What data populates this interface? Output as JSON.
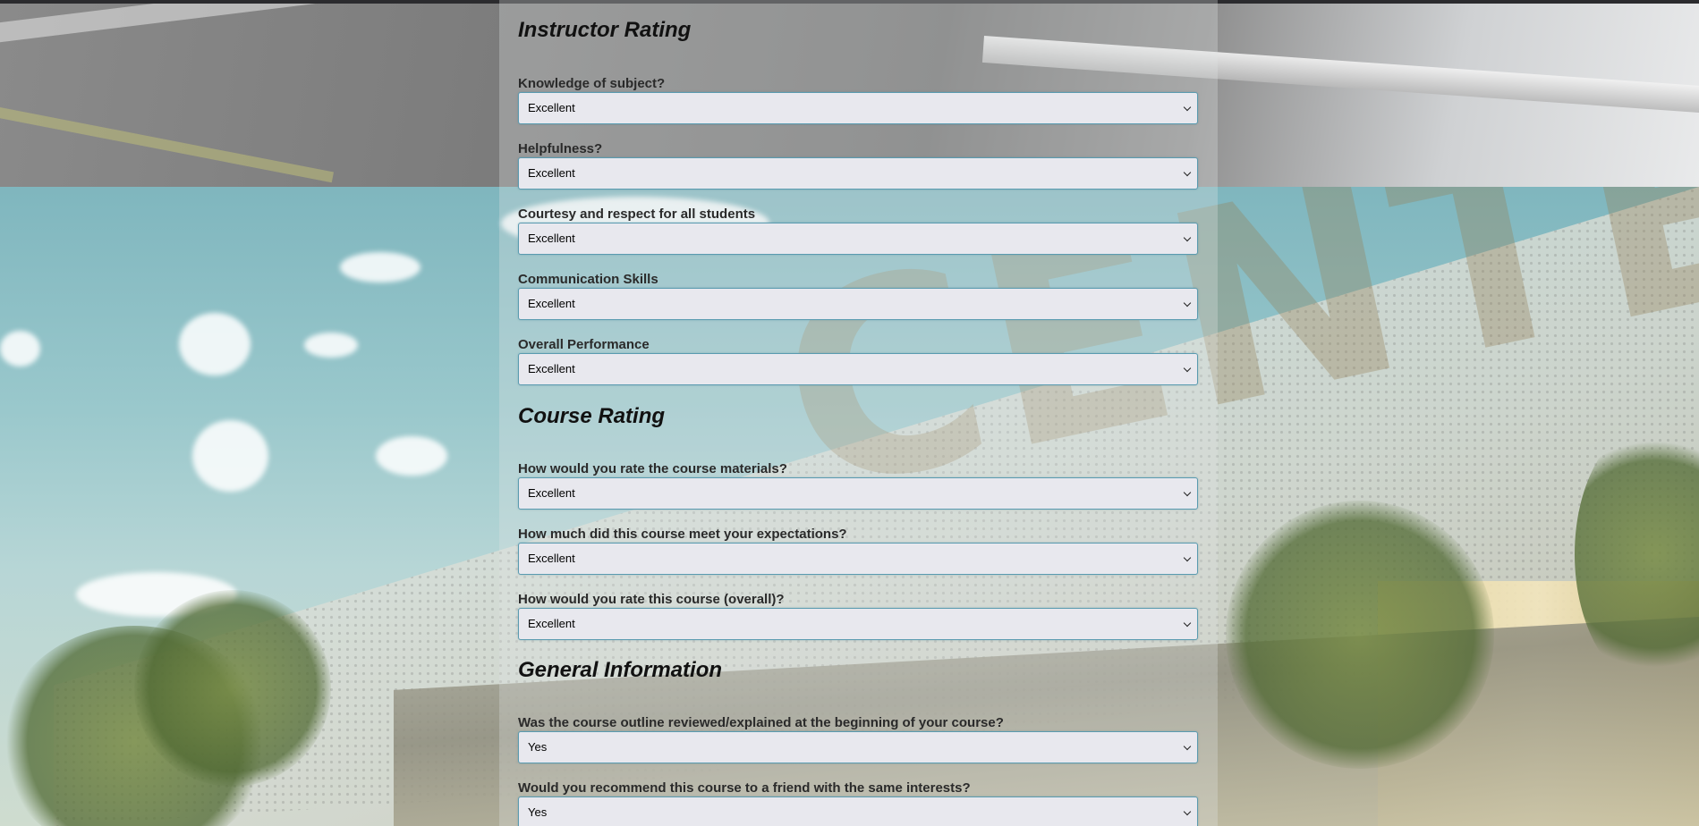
{
  "sections": [
    {
      "title": "Instructor Rating",
      "questions": [
        {
          "label": "Knowledge of subject?",
          "value": "Excellent"
        },
        {
          "label": "Helpfulness?",
          "value": "Excellent"
        },
        {
          "label": "Courtesy and respect for all students",
          "value": "Excellent"
        },
        {
          "label": "Communication Skills",
          "value": "Excellent"
        },
        {
          "label": "Overall Performance",
          "value": "Excellent"
        }
      ]
    },
    {
      "title": "Course Rating",
      "questions": [
        {
          "label": "How would you rate the course materials?",
          "value": "Excellent"
        },
        {
          "label": "How much did this course meet your expectations?",
          "value": "Excellent"
        },
        {
          "label": "How would you rate this course (overall)?",
          "value": "Excellent"
        }
      ]
    },
    {
      "title": "General Information",
      "questions": [
        {
          "label": "Was the course outline reviewed/explained at the beginning of your course?",
          "value": "Yes"
        },
        {
          "label": "Would you recommend this course to a friend with the same interests?",
          "value": "Yes"
        }
      ]
    }
  ],
  "background": {
    "sign_text": "CENTENNIAL"
  }
}
